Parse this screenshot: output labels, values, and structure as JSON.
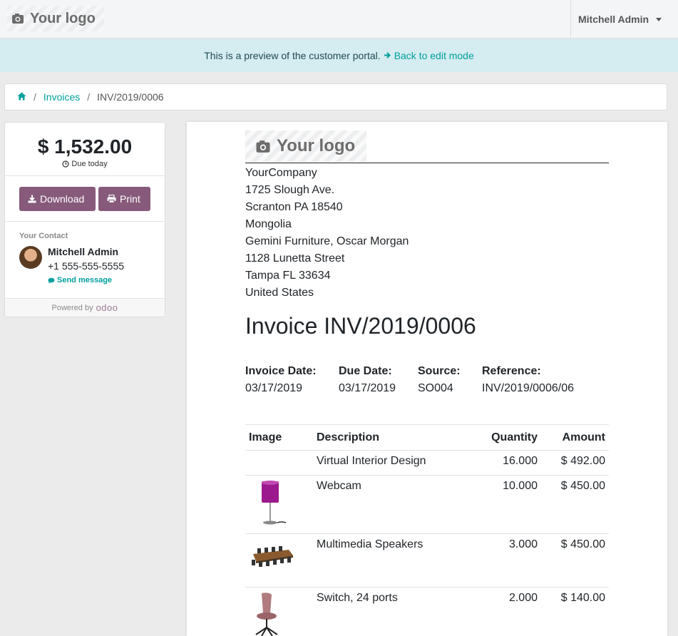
{
  "navbar": {
    "logo_text": "Your logo",
    "user_name": "Mitchell Admin"
  },
  "preview": {
    "message": "This is a preview of the customer portal.",
    "link": "Back to edit mode"
  },
  "breadcrumb": {
    "home_icon": "home-icon",
    "invoices": "Invoices",
    "current": "INV/2019/0006"
  },
  "sidebar": {
    "amount": "$ 1,532.00",
    "due": "Due today",
    "download_label": "Download",
    "print_label": "Print",
    "contact_title": "Your Contact",
    "contact_name": "Mitchell Admin",
    "contact_phone": "+1 555-555-5555",
    "send_message": "Send message",
    "powered_by": "Powered by",
    "powered_brand": "odoo"
  },
  "document": {
    "logo_text": "Your logo",
    "address_lines": [
      "YourCompany",
      "1725 Slough Ave.",
      "Scranton PA 18540",
      "Mongolia",
      "Gemini Furniture, Oscar Morgan",
      "1128 Lunetta Street",
      "Tampa FL 33634",
      "United States"
    ],
    "title": "Invoice INV/2019/0006",
    "info": {
      "invoice_date_label": "Invoice Date:",
      "invoice_date": "03/17/2019",
      "due_date_label": "Due Date:",
      "due_date": "03/17/2019",
      "source_label": "Source:",
      "source": "SO004",
      "reference_label": "Reference:",
      "reference": "INV/2019/0006/06"
    },
    "table": {
      "headers": {
        "image": "Image",
        "description": "Description",
        "quantity": "Quantity",
        "amount": "Amount"
      },
      "rows": [
        {
          "description": "Virtual Interior Design",
          "quantity": "16.000",
          "amount": "$ 492.00"
        },
        {
          "description": "Webcam",
          "quantity": "10.000",
          "amount": "$ 450.00"
        },
        {
          "description": "Multimedia Speakers",
          "quantity": "3.000",
          "amount": "$ 450.00"
        },
        {
          "description": "Switch, 24 ports",
          "quantity": "2.000",
          "amount": "$ 140.00"
        }
      ]
    }
  },
  "colors": {
    "primary": "#875a7b",
    "link": "#00a09d",
    "banner": "#d5ecf1"
  }
}
